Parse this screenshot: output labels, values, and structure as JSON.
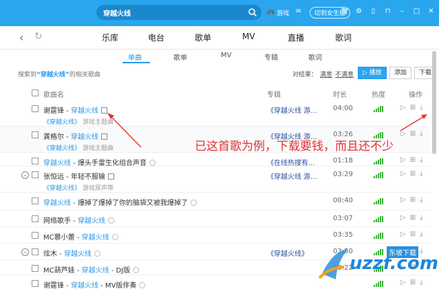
{
  "topbar": {
    "search_text": "穿越火线",
    "game_label": "游戏",
    "switch_label": "切到女生版",
    "bg_color": "#2aa6ef"
  },
  "nav": {
    "tabs": [
      "乐库",
      "电台",
      "歌单",
      "MV",
      "直播",
      "歌词"
    ]
  },
  "subtabs": [
    "单曲",
    "歌单",
    "MV",
    "专辑",
    "歌词"
  ],
  "info": {
    "prefix": "搜索到",
    "keyword": "“穿越火线”",
    "suffix": "的相关歌曲",
    "filter_label": "对结果：",
    "filter_a": "满意",
    "filter_b": "不满意",
    "play_btn": "播放",
    "add_btn": "添加",
    "download_btn": "下载"
  },
  "table_head": {
    "name": "歌曲名",
    "album": "专辑",
    "duration": "时长",
    "heat": "热度",
    "ops": "操作"
  },
  "rows": [
    {
      "artist": "谢霆锋 - ",
      "title": "穿越火线",
      "mv": true,
      "sub_tag": "《穿越火线》",
      "sub_desc": "游戏主题曲",
      "album": "《穿越火线 游...",
      "duration": "04:00"
    },
    {
      "artist": "龚格尔 - ",
      "title": "穿越火线",
      "mv": true,
      "sub_tag": "《穿越火线》",
      "sub_desc": "游戏主题曲",
      "album": "《穿越火线 游...",
      "duration": "03:26"
    },
    {
      "artist": "",
      "title": "穿越火线",
      "rest": " - 爆头手雷生化组合声音",
      "album": "《在线热搜有...",
      "duration": "01:18"
    },
    {
      "artist": "张恒远 - 年轻不服输",
      "title": "",
      "mv": true,
      "expand": true,
      "sub_tag": "《穿越火线》",
      "sub_desc": "游戏原声带",
      "album": "《穿越火线 游...",
      "duration": "03:29"
    },
    {
      "artist": "",
      "title": "穿越火线",
      "rest": " - 爆掉了爆掉了你的脑袋又被我爆掉了",
      "album": "",
      "duration": "00:40"
    },
    {
      "artist": "网络歌手 - ",
      "title": "穿越火线",
      "album": "",
      "duration": "03:07"
    },
    {
      "artist": "MC慕小蕾 - ",
      "title": "穿越火线",
      "album": "",
      "duration": "03:35"
    },
    {
      "artist": "炫木 - ",
      "title": "穿越火线",
      "expand": true,
      "album": "《穿越火线》",
      "duration": "03:50"
    },
    {
      "artist": "MC葫芦娃 - ",
      "title": "穿越火线",
      "rest": " - DJ版",
      "album": "",
      "duration": "03:22"
    },
    {
      "artist": "谢霆锋 - ",
      "title": "穿越火线",
      "rest": " - MV版伴奏",
      "album": "",
      "duration": ""
    }
  ],
  "annotation": "已这首歌为例，下载要钱，而且还不少",
  "watermark": {
    "text": "uzzf.com",
    "cn": "东坡下载"
  }
}
